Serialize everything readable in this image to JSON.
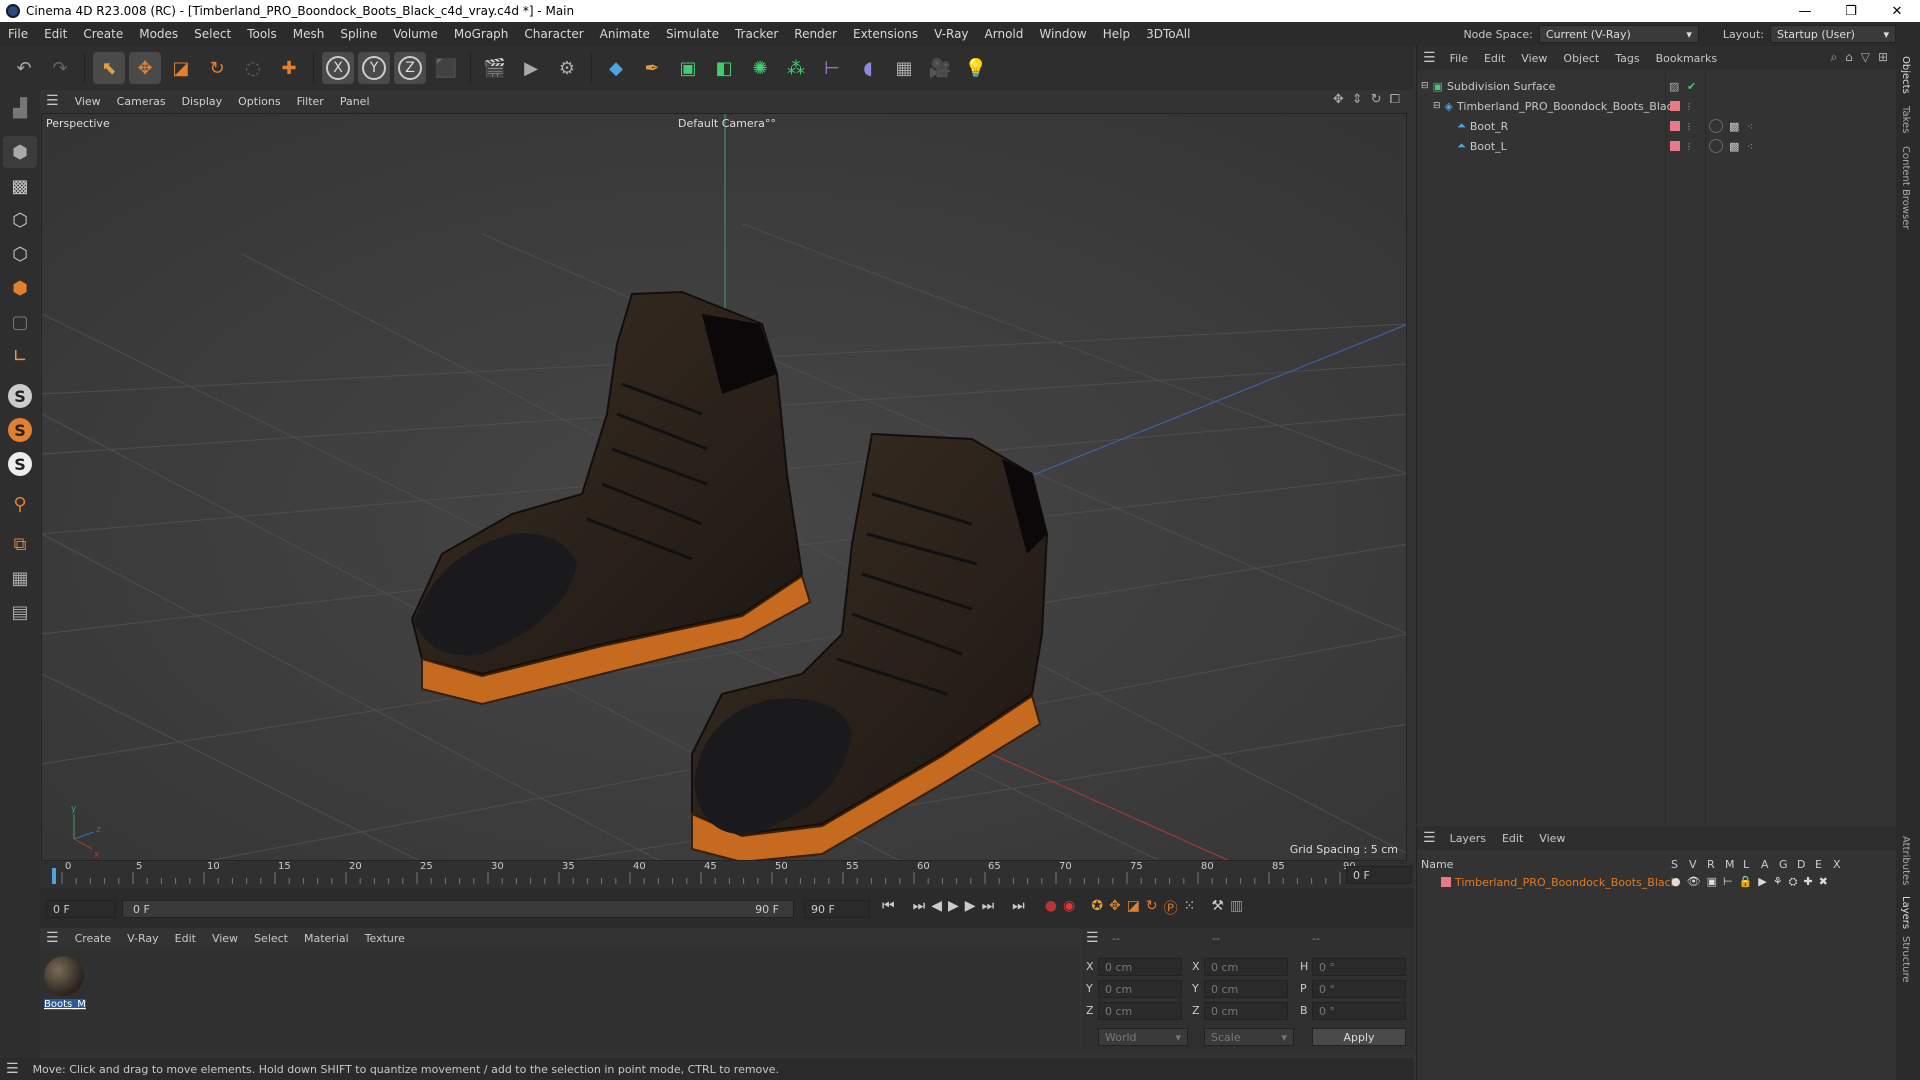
{
  "window": {
    "title": "Cinema 4D R23.008 (RC) - [Timberland_PRO_Boondock_Boots_Black_c4d_vray.c4d *] - Main",
    "min": "—",
    "max": "❐",
    "close": "✕"
  },
  "menu": {
    "items": [
      "File",
      "Edit",
      "Create",
      "Modes",
      "Select",
      "Tools",
      "Mesh",
      "Spline",
      "Volume",
      "MoGraph",
      "Character",
      "Animate",
      "Simulate",
      "Tracker",
      "Render",
      "Extensions",
      "V-Ray",
      "Arnold",
      "Window",
      "Help",
      "3DToAll"
    ],
    "node_space_label": "Node Space:",
    "node_space_value": "Current (V-Ray)",
    "layout_label": "Layout:",
    "layout_value": "Startup (User)"
  },
  "viewport": {
    "menu": [
      "View",
      "Cameras",
      "Display",
      "Options",
      "Filter",
      "Panel"
    ],
    "view_name": "Perspective",
    "camera": "Default Camera",
    "camera_suffix": "°°",
    "grid_spacing": "Grid Spacing : 5 cm"
  },
  "timeline": {
    "ticks": [
      "0",
      "5",
      "10",
      "15",
      "20",
      "25",
      "30",
      "35",
      "40",
      "45",
      "50",
      "55",
      "60",
      "65",
      "70",
      "75",
      "80",
      "85",
      "90"
    ],
    "end_field": "0 F",
    "start_field": "0 F",
    "range_start": "0 F",
    "range_end": "90 F",
    "max_field": "90 F"
  },
  "material": {
    "menu": [
      "Create",
      "V-Ray",
      "Edit",
      "View",
      "Select",
      "Material",
      "Texture"
    ],
    "swatch_label": "Boots_M"
  },
  "coords": {
    "header": [
      "--",
      "--",
      "--"
    ],
    "rows": [
      {
        "a": "X",
        "av": "0 cm",
        "b": "X",
        "bv": "0 cm",
        "c": "H",
        "cv": "0 °"
      },
      {
        "a": "Y",
        "av": "0 cm",
        "b": "Y",
        "bv": "0 cm",
        "c": "P",
        "cv": "0 °"
      },
      {
        "a": "Z",
        "av": "0 cm",
        "b": "Z",
        "bv": "0 cm",
        "c": "B",
        "cv": "0 °"
      }
    ],
    "world": "World",
    "scale": "Scale",
    "apply": "Apply"
  },
  "status": "Move: Click and drag to move elements. Hold down SHIFT to quantize movement / add to the selection in point mode, CTRL to remove.",
  "objects": {
    "menu": [
      "File",
      "Edit",
      "View",
      "Object",
      "Tags",
      "Bookmarks"
    ],
    "rows": [
      {
        "name": "Subdivision Surface",
        "indent": 0
      },
      {
        "name": "Timberland_PRO_Boondock_Boots_Black",
        "indent": 1
      },
      {
        "name": "Boot_R",
        "indent": 2
      },
      {
        "name": "Boot_L",
        "indent": 2
      }
    ]
  },
  "layers": {
    "menu": [
      "Layers",
      "Edit",
      "View"
    ],
    "header_name": "Name",
    "header_cols": [
      "S",
      "V",
      "R",
      "M",
      "L",
      "A",
      "G",
      "D",
      "E",
      "X"
    ],
    "row": "Timberland_PRO_Boondock_Boots_Black"
  },
  "right_tabs": [
    "Objects",
    "Takes",
    "Content Browser",
    "Attributes",
    "Layers",
    "Structure"
  ],
  "colors": {
    "accent_orange": "#e07b20",
    "layer_pink": "#e87a8a",
    "boot_leather": "#2a221c"
  }
}
